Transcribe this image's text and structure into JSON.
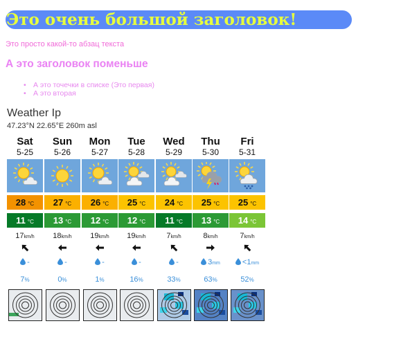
{
  "page": {
    "heading": "Это очень большой заголовок!",
    "paragraph": "Это просто какой-то абзац текста",
    "subheading": "А это заголовок поменьше",
    "list": [
      "А это точечки в списке (Это первая)",
      "А это вторая"
    ]
  },
  "widget": {
    "title": "Weather Ip",
    "coords": "47.23°N 22.65°E 260m asl",
    "temp_unit": "°C",
    "wind_unit": "km/h",
    "prob_unit": "%",
    "days": [
      {
        "day": "Sat",
        "date": "5-25",
        "icon": "sun-cloud-icon",
        "tmax": "28",
        "tmax_color": "#f39200",
        "tmin": "11",
        "tmin_color": "#067a28",
        "wind": "17",
        "wind_dir": "nw",
        "precip": "-",
        "precip_unit": "",
        "prob": "7"
      },
      {
        "day": "Sun",
        "date": "5-26",
        "icon": "sun-icon",
        "tmax": "27",
        "tmax_color": "#fbb000",
        "tmin": "13",
        "tmin_color": "#2c9a35",
        "wind": "18",
        "wind_dir": "w",
        "precip": "-",
        "precip_unit": "",
        "prob": "0"
      },
      {
        "day": "Mon",
        "date": "5-27",
        "icon": "sun-cloud-icon",
        "tmax": "26",
        "tmax_color": "#fbb000",
        "tmin": "12",
        "tmin_color": "#2c9a35",
        "wind": "19",
        "wind_dir": "w",
        "precip": "-",
        "precip_unit": "",
        "prob": "1"
      },
      {
        "day": "Tue",
        "date": "5-28",
        "icon": "sun-clouds-icon",
        "tmax": "25",
        "tmax_color": "#fcc300",
        "tmin": "12",
        "tmin_color": "#2c9a35",
        "wind": "19",
        "wind_dir": "w",
        "precip": "-",
        "precip_unit": "",
        "prob": "16"
      },
      {
        "day": "Wed",
        "date": "5-29",
        "icon": "sun-clouds-icon",
        "tmax": "24",
        "tmax_color": "#fcc300",
        "tmin": "11",
        "tmin_color": "#067a28",
        "wind": "7",
        "wind_dir": "nw",
        "precip": "-",
        "precip_unit": "",
        "prob": "33"
      },
      {
        "day": "Thu",
        "date": "5-30",
        "icon": "thunderstorm-icon",
        "tmax": "25",
        "tmax_color": "#fcc300",
        "tmin": "13",
        "tmin_color": "#2c9a35",
        "wind": "8",
        "wind_dir": "e",
        "precip": "3",
        "precip_unit": "mm",
        "prob": "63"
      },
      {
        "day": "Fri",
        "date": "5-31",
        "icon": "sun-cloud-rain-icon",
        "tmax": "25",
        "tmax_color": "#fcc300",
        "tmin": "14",
        "tmin_color": "#7bc536",
        "wind": "7",
        "wind_dir": "nw",
        "precip": "<1",
        "precip_unit": "mm",
        "prob": "52"
      }
    ],
    "radar_icons": [
      "radar-chart-icon",
      "radar-chart-icon",
      "radar-chart-icon",
      "radar-chart-icon",
      "radar-chart-icon",
      "radar-chart-icon",
      "radar-chart-icon"
    ]
  },
  "colors": {
    "heading_bg": "#5b8af7",
    "heading_text": "#e8ff3c",
    "pink": "#f06ad8",
    "icon_bg": "#6fa6dc",
    "precip_blue": "#3a8fd9"
  }
}
